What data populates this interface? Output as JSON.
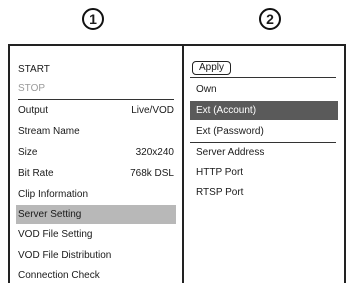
{
  "callouts": {
    "left": "1",
    "right": "2"
  },
  "left_menu": {
    "start": "START",
    "stop": "STOP",
    "items": [
      {
        "label": "Output",
        "value": "Live/VOD"
      },
      {
        "label": "Stream Name",
        "value": ""
      },
      {
        "label": "Size",
        "value": "320x240"
      },
      {
        "label": "Bit Rate",
        "value": "768k DSL"
      },
      {
        "label": "Clip Information",
        "value": ""
      },
      {
        "label": "Server Setting",
        "value": "",
        "selected": true
      },
      {
        "label": "VOD File Setting",
        "value": ""
      },
      {
        "label": "VOD File Distribution",
        "value": ""
      },
      {
        "label": "Connection Check",
        "value": ""
      }
    ]
  },
  "right_menu": {
    "apply": "Apply",
    "items": [
      {
        "label": "Own"
      },
      {
        "label": "Ext (Account)",
        "highlighted": true
      },
      {
        "label": "Ext (Password)"
      },
      {
        "label": "Server Address"
      },
      {
        "label": "HTTP Port"
      },
      {
        "label": "RTSP Port"
      }
    ]
  },
  "colors": {
    "selected_row": "#b8b8b8",
    "highlight_row": "#5a5a5a",
    "disabled_text": "#9a9a9a"
  }
}
